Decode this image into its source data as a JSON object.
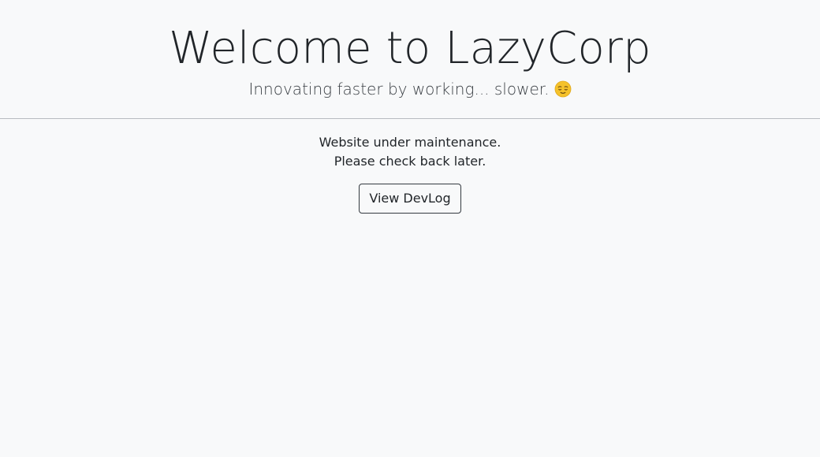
{
  "header": {
    "title": "Welcome to LazyCorp",
    "subtitle": "Innovating faster by working... slower.",
    "emoji_icon": "relieved-face-icon"
  },
  "main": {
    "message_line1": "Website under maintenance.",
    "message_line2": "Please check back later.",
    "button_label": "View DevLog"
  },
  "colors": {
    "background": "#f8f9fa",
    "text": "#212529",
    "emoji": "#f5c22b"
  }
}
